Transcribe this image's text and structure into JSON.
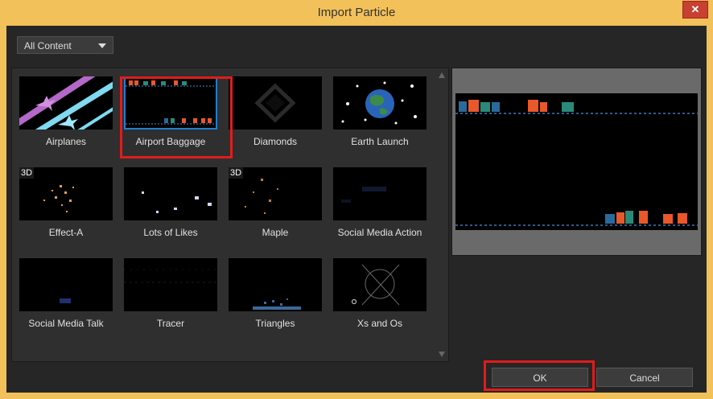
{
  "window": {
    "title": "Import Particle",
    "close_label": "✕"
  },
  "filter": {
    "selected": "All Content"
  },
  "particles": [
    {
      "label": "Airplanes",
      "badge": ""
    },
    {
      "label": "Airport Baggage",
      "badge": "",
      "selected": true
    },
    {
      "label": "Diamonds",
      "badge": ""
    },
    {
      "label": "Earth Launch",
      "badge": ""
    },
    {
      "label": "Effect-A",
      "badge": "3D"
    },
    {
      "label": "Lots of Likes",
      "badge": ""
    },
    {
      "label": "Maple",
      "badge": "3D"
    },
    {
      "label": "Social Media Action",
      "badge": ""
    },
    {
      "label": "Social Media Talk",
      "badge": ""
    },
    {
      "label": "Tracer",
      "badge": ""
    },
    {
      "label": "Triangles",
      "badge": ""
    },
    {
      "label": "Xs and Os",
      "badge": ""
    }
  ],
  "buttons": {
    "ok": "OK",
    "cancel": "Cancel"
  },
  "colors": {
    "selection": "#e21b1b",
    "accent": "#1e7fd0"
  },
  "icons": {
    "dropdown": "chevron-down-icon",
    "close": "close-icon"
  }
}
